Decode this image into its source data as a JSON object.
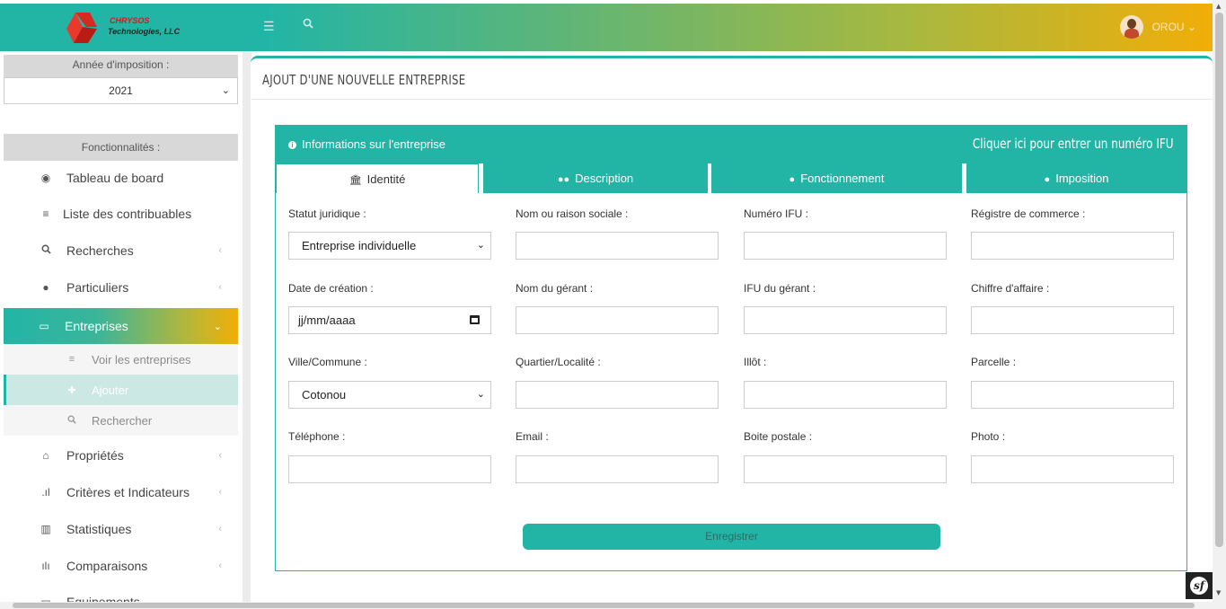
{
  "brand": {
    "line1": "CHRYSOS",
    "line2": "Technologies, LLC",
    "logo_color": "#c9201f"
  },
  "topbar": {
    "menu_icon": "hamburger-icon",
    "search_icon": "search-icon",
    "user_name": "OROU",
    "user_chevron": "⌄"
  },
  "colors": {
    "accent": "#22b5a6",
    "gradient_end": "#f1ae08"
  },
  "sidebar": {
    "year_heading": "Année d'imposition :",
    "year_value": "2021",
    "features_heading": "Fonctionnalités :",
    "items": [
      {
        "label": "Tableau de board",
        "icon": "dashboard-icon"
      },
      {
        "label": "Liste des contribuables",
        "icon": "list-icon"
      },
      {
        "label": "Recherches",
        "icon": "search-icon"
      },
      {
        "label": "Particuliers",
        "icon": "user-icon"
      },
      {
        "label": "Entreprises",
        "icon": "desktop-icon"
      },
      {
        "label": "Propriétés",
        "icon": "home-icon"
      },
      {
        "label": "Critères et Indicateurs",
        "icon": "signal-icon"
      },
      {
        "label": "Statistiques",
        "icon": "bar-chart-icon"
      },
      {
        "label": "Comparaisons",
        "icon": "stats-icon"
      },
      {
        "label": "Equipements",
        "icon": "equipment-icon"
      }
    ],
    "subitems": [
      {
        "label": "Voir les entreprises",
        "icon": "list-icon"
      },
      {
        "label": "Ajouter",
        "icon": "plus-icon"
      },
      {
        "label": "Rechercher",
        "icon": "search-icon"
      }
    ]
  },
  "main": {
    "page_title": "AJOUT D'UNE NOUVELLE ENTREPRISE",
    "panel_title": "Informations sur l'entreprise",
    "ifu_link": "Cliquer ici pour entrer un numéro IFU",
    "tabs": [
      {
        "label": "Identité",
        "icon": "bank-icon"
      },
      {
        "label": "Description",
        "icon": "users-icon"
      },
      {
        "label": "Fonctionnement",
        "icon": "user-icon"
      },
      {
        "label": "Imposition",
        "icon": "user-icon"
      }
    ],
    "fields": {
      "statut_label": "Statut juridique :",
      "statut_value": "Entreprise individuelle",
      "nom_label": "Nom ou raison sociale :",
      "ifu_label": "Numéro IFU :",
      "registre_label": "Régistre de commerce :",
      "date_label": "Date de création :",
      "date_placeholder": "jj/mm/aaaa",
      "gerant_label": "Nom du gérant :",
      "ifu_gerant_label": "IFU du gérant :",
      "chiffre_label": "Chiffre d'affaire :",
      "ville_label": "Ville/Commune :",
      "ville_value": "Cotonou",
      "quartier_label": "Quartier/Localité :",
      "ilot_label": "Illôt :",
      "parcelle_label": "Parcelle :",
      "telephone_label": "Téléphone :",
      "email_label": "Email :",
      "bp_label": "Boite postale :",
      "photo_label": "Photo :"
    },
    "save_label": "Enregistrer"
  }
}
